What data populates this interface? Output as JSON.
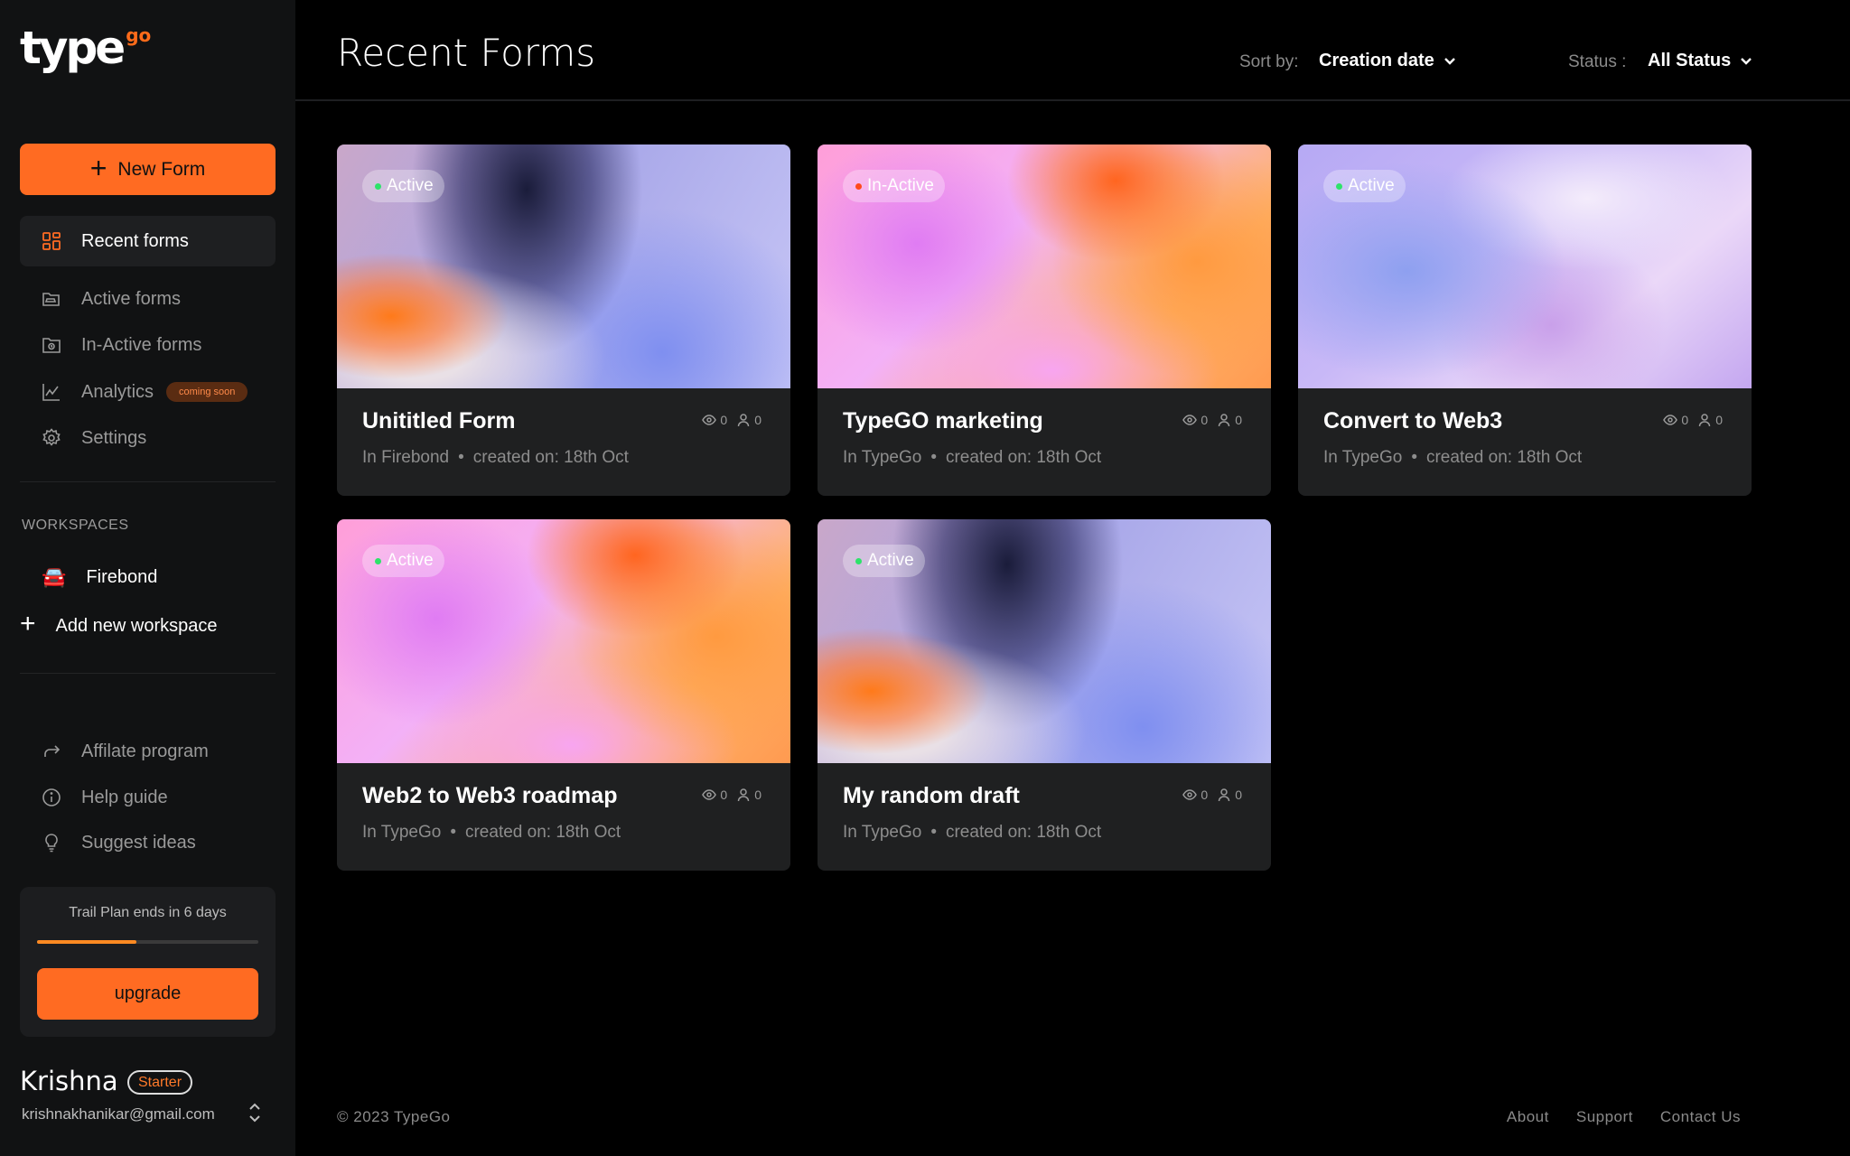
{
  "brand": {
    "name": "type",
    "superscript": "go"
  },
  "sidebar": {
    "new_form_label": "New Form",
    "nav": [
      {
        "label": "Recent forms",
        "icon": "grid-icon",
        "active": true
      },
      {
        "label": "Active forms",
        "icon": "folder-open-icon"
      },
      {
        "label": "In-Active forms",
        "icon": "folder-clock-icon"
      },
      {
        "label": "Analytics",
        "icon": "chart-icon",
        "badge": "coming soon"
      },
      {
        "label": "Settings",
        "icon": "gear-icon"
      }
    ],
    "workspaces_label": "WORKSPACES",
    "workspaces": [
      {
        "label": "Firebond",
        "icon": "car-icon"
      }
    ],
    "add_workspace_label": "Add new workspace",
    "secondary": [
      {
        "label": "Affilate program",
        "icon": "share-arrow-icon"
      },
      {
        "label": "Help guide",
        "icon": "info-icon"
      },
      {
        "label": "Suggest ideas",
        "icon": "lightbulb-icon"
      }
    ],
    "trial": {
      "text": "Trail Plan ends in 6 days",
      "progress": 0.45,
      "upgrade_label": "upgrade"
    },
    "user": {
      "name": "Krishna",
      "plan": "Starter",
      "email": "krishnakhanikar@gmail.com"
    }
  },
  "header": {
    "title": "Recent Forms",
    "sort_label": "Sort by:",
    "sort_value": "Creation date",
    "status_label": "Status :",
    "status_value": "All Status"
  },
  "cards": [
    {
      "title": "Unititled Form",
      "status": "Active",
      "workspace": "In Firebond",
      "created": "created on: 18th Oct",
      "views": "0",
      "responses": "0"
    },
    {
      "title": "TypeGO marketing",
      "status": "In-Active",
      "workspace": "In TypeGo",
      "created": "created on: 18th Oct",
      "views": "0",
      "responses": "0"
    },
    {
      "title": "Convert to Web3",
      "status": "Active",
      "workspace": "In TypeGo",
      "created": "created on: 18th Oct",
      "views": "0",
      "responses": "0"
    },
    {
      "title": "Web2 to Web3 roadmap",
      "status": "Active",
      "workspace": "In TypeGo",
      "created": "created on: 18th Oct",
      "views": "0",
      "responses": "0"
    },
    {
      "title": "My random draft",
      "status": "Active",
      "workspace": "In TypeGo",
      "created": "created on: 18th Oct",
      "views": "0",
      "responses": "0"
    }
  ],
  "footer": {
    "copyright": "© 2023 TypeGo",
    "links": [
      "About",
      "Support",
      "Contact Us"
    ]
  },
  "colors": {
    "accent": "#ff6b22",
    "active_dot": "#2ee36a",
    "inactive_dot": "#ff4a1a",
    "background": "#000000",
    "sidebar": "#111213",
    "card": "#1f2021"
  }
}
